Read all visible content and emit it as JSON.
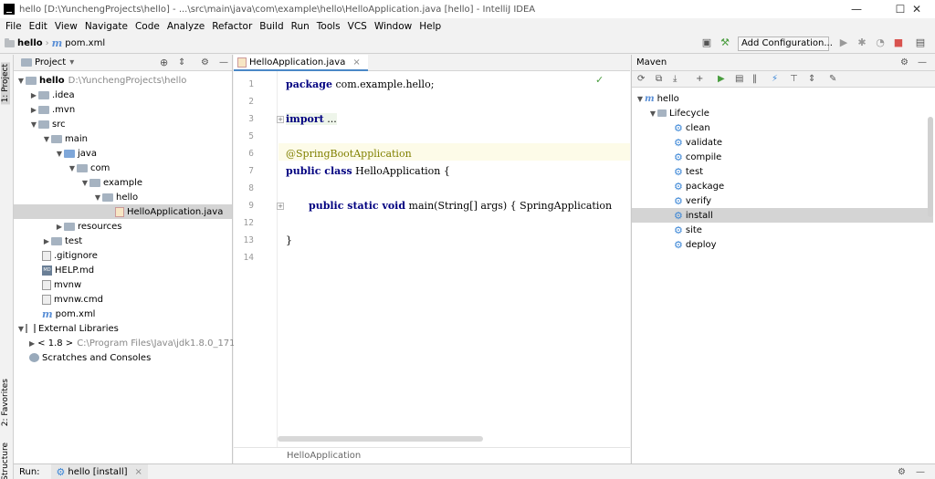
{
  "window": {
    "title": "hello [D:\\YunchengProjects\\hello] - ...\\src\\main\\java\\com\\example\\hello\\HelloApplication.java [hello] - IntelliJ IDEA",
    "minimize": "—",
    "maximize": "☐",
    "close": "✕"
  },
  "menu": [
    "File",
    "Edit",
    "View",
    "Navigate",
    "Code",
    "Analyze",
    "Refactor",
    "Build",
    "Run",
    "Tools",
    "VCS",
    "Window",
    "Help"
  ],
  "nav": {
    "project": "hello",
    "file": "pom.xml",
    "run_config": "Add Configuration..."
  },
  "left_strip": {
    "project_tab": "1: Project",
    "favorites_tab": "2: Favorites",
    "structure_tab": "Structure"
  },
  "project_panel": {
    "title": "Project",
    "tree": [
      {
        "label": "hello",
        "extra": "D:\\YunchengProjects\\hello"
      },
      {
        "label": ".idea"
      },
      {
        "label": ".mvn"
      },
      {
        "label": "src"
      },
      {
        "label": "main"
      },
      {
        "label": "java"
      },
      {
        "label": "com"
      },
      {
        "label": "example"
      },
      {
        "label": "hello"
      },
      {
        "label": "HelloApplication.java"
      },
      {
        "label": "resources"
      },
      {
        "label": "test"
      },
      {
        "label": ".gitignore"
      },
      {
        "label": "HELP.md"
      },
      {
        "label": "mvnw"
      },
      {
        "label": "mvnw.cmd"
      },
      {
        "label": "pom.xml"
      },
      {
        "label": "External Libraries"
      },
      {
        "label": "< 1.8 >",
        "extra": "C:\\Program Files\\Java\\jdk1.8.0_171"
      },
      {
        "label": "Scratches and Consoles"
      }
    ]
  },
  "editor": {
    "tab": "HelloApplication.java",
    "line_numbers": [
      "1",
      "2",
      "3",
      "5",
      "6",
      "7",
      "8",
      "9",
      "12",
      "13",
      "14"
    ],
    "lines": {
      "l1_kw": "package",
      "l1_rest": " com.example.hello;",
      "l3_kw": "import",
      "l3_rest": " ...",
      "l6": "@SpringBootApplication",
      "l7_kw": "public class",
      "l7_rest": " HelloApplication {",
      "l9_kw": "public static void",
      "l9_rest": " main(String[] args) { SpringApplication",
      "l13": "}"
    },
    "breadcrumb": "HelloApplication"
  },
  "maven": {
    "title": "Maven",
    "root": "hello",
    "lifecycle": "Lifecycle",
    "goals": [
      "clean",
      "validate",
      "compile",
      "test",
      "package",
      "verify",
      "install",
      "site",
      "deploy"
    ]
  },
  "bottom": {
    "run_label": "Run:",
    "run_tab": "hello [install]"
  }
}
